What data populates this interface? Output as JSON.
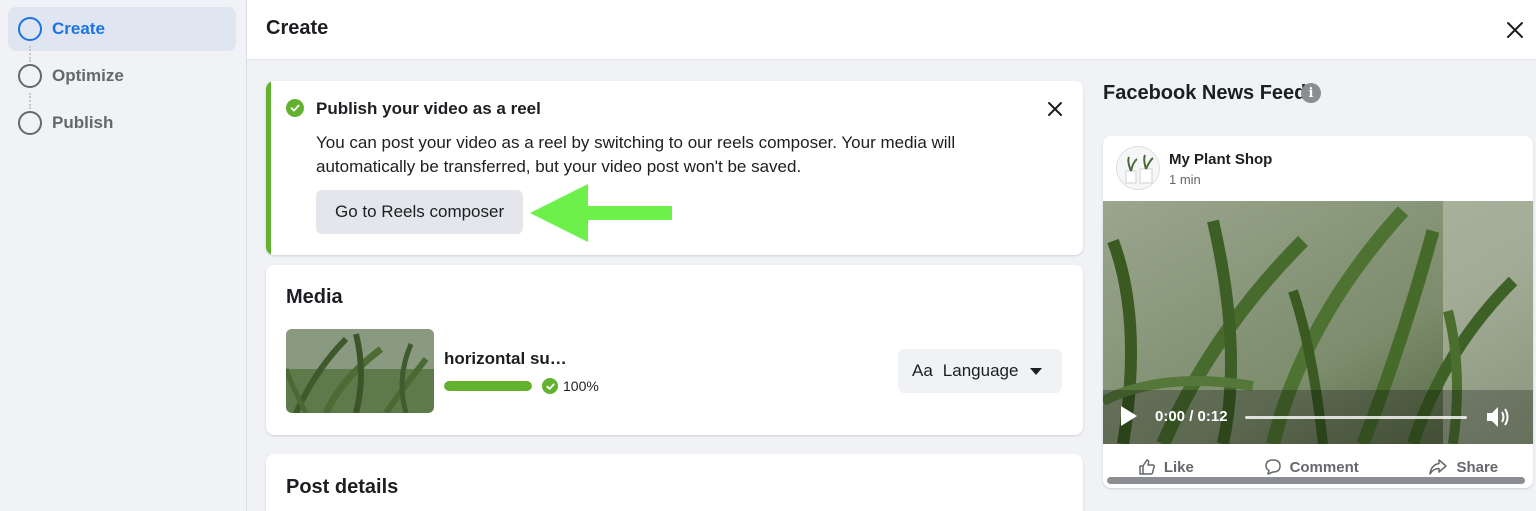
{
  "sidebar": {
    "steps": [
      {
        "label": "Create",
        "active": true
      },
      {
        "label": "Optimize",
        "active": false
      },
      {
        "label": "Publish",
        "active": false
      }
    ]
  },
  "header": {
    "title": "Create",
    "close_icon": "close-icon"
  },
  "reel_banner": {
    "heading": "Publish your video as a reel",
    "body": "You can post your video as a reel by switching to our reels composer. Your media will automatically be transferred, but your video post won't be saved.",
    "button_label": "Go to Reels composer",
    "accent_color": "#62b22f",
    "annotation_arrow_color": "#6ef04a"
  },
  "media": {
    "title": "Media",
    "filename": "horizontal succulent",
    "progress_percent": 100,
    "progress_label": "100%",
    "language_button": {
      "icon_text": "Aa",
      "label": "Language"
    }
  },
  "post_details": {
    "title": "Post details"
  },
  "preview": {
    "title": "Facebook News Feed",
    "page_name": "My Plant Shop",
    "post_time": "1 min",
    "video_time": "0:00 / 0:12",
    "actions": [
      "Like",
      "Comment",
      "Share"
    ]
  },
  "colors": {
    "brand_blue": "#1b74e4",
    "success_green": "#62b22f",
    "page_bg": "#f0f2f5"
  }
}
